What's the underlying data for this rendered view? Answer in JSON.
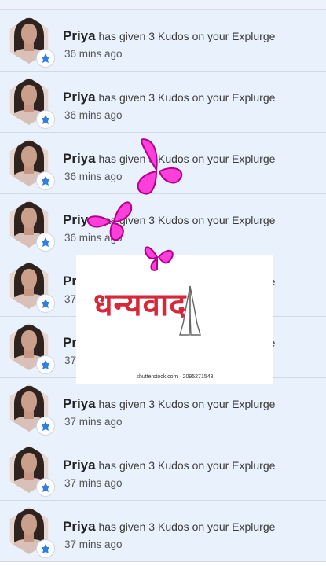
{
  "notifications": [
    {
      "name": "Priya",
      "action": "has given 3 Kudos on your Explurge",
      "time": "36 mins ago"
    },
    {
      "name": "Priya",
      "action": "has given 3 Kudos on your Explurge",
      "time": "36 mins ago"
    },
    {
      "name": "Priya",
      "action": "has given 3 Kudos on your Explurge",
      "time": "36 mins ago"
    },
    {
      "name": "Priya",
      "action": "has given 3 Kudos on your Explurge",
      "time": "36 mins ago"
    },
    {
      "name": "Priya",
      "action": "has given 3 Kudos on your Explurge",
      "time": "37 mins ago"
    },
    {
      "name": "Priya",
      "action": "has given 3 Kudos on your Explurge",
      "time": "37 mins ago"
    },
    {
      "name": "Priya",
      "action": "has given 3 Kudos on your Explurge",
      "time": "37 mins ago"
    },
    {
      "name": "Priya",
      "action": "has given 3 Kudos on your Explurge",
      "time": "37 mins ago"
    },
    {
      "name": "Priya",
      "action": "has given 3 Kudos on your Explurge",
      "time": "37 mins ago"
    }
  ],
  "overlay": {
    "text": "धन्यवाद",
    "credit": "shutterstock.com · 2095271548"
  },
  "colors": {
    "row_bg": "#e9f1fd",
    "badge_icon": "#2f7fe0",
    "accent_red": "#d6283a",
    "butterfly": "#ff2bd6"
  },
  "icons": {
    "badge": "kudos-hand-icon",
    "decor": "butterfly-icon",
    "overlay": "folded-hands-icon"
  }
}
